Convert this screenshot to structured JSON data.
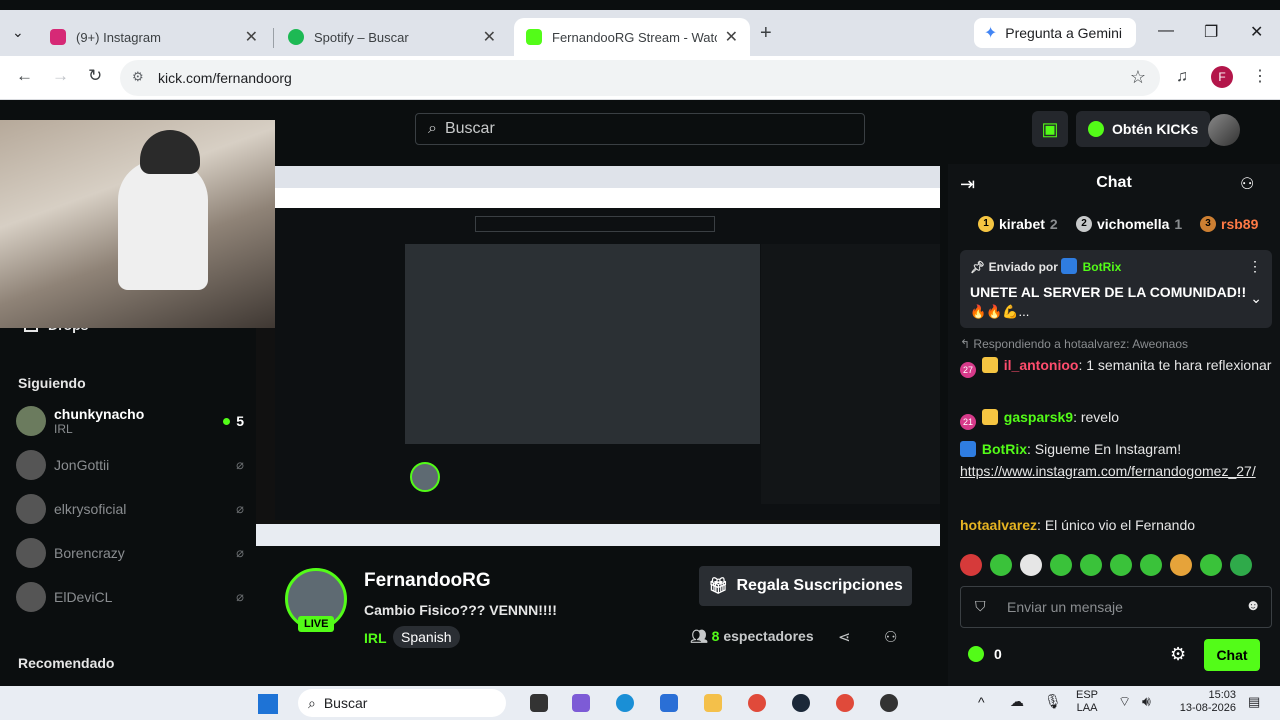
{
  "browser": {
    "tabs": [
      {
        "title": "(9+) Instagram",
        "favicon": "instagram-icon",
        "color": "#d62976"
      },
      {
        "title": "Spotify – Buscar",
        "favicon": "spotify-icon",
        "color": "#1db954"
      },
      {
        "title": "FernandooRG Stream - Watch l",
        "favicon": "kick-icon",
        "color": "#53fc18"
      }
    ],
    "gemini_label": "Pregunta a Gemini",
    "url": "kick.com/fernandoorg",
    "profile_initial": "F"
  },
  "kick": {
    "search_placeholder": "Buscar",
    "kicks_label": "Obtén KICKs",
    "sidebar": {
      "drops_label": "Drops",
      "following_label": "Siguiendo",
      "recommended_label": "Recomendado",
      "channels": [
        {
          "name": "chunkynacho",
          "category": "IRL",
          "viewers": "5",
          "live": true
        },
        {
          "name": "JonGottii",
          "live": false
        },
        {
          "name": "elkrysoficial",
          "live": false
        },
        {
          "name": "Borencrazy",
          "live": false
        },
        {
          "name": "ElDeviCL",
          "live": false
        }
      ]
    },
    "channel": {
      "name": "FernandooRG",
      "live_label": "LIVE",
      "title": "Cambio Fisico??? VENNN!!!!",
      "category": "IRL",
      "language": "Spanish",
      "subscribe_label": "Regala Suscripciones",
      "viewers_count": "8",
      "viewers_label": "espectadores"
    },
    "chat": {
      "title": "Chat",
      "gifters": [
        {
          "rank": "1",
          "name": "kirabet",
          "count": "2"
        },
        {
          "rank": "2",
          "name": "vichomella",
          "count": "1"
        },
        {
          "rank": "3",
          "name": "rsb89"
        }
      ],
      "pinned": {
        "by_label": "Enviado por",
        "by_user": "BotRix",
        "text": "UNETE AL SERVER DE LA COMUNIDAD!!",
        "emoji": "🔥🔥💪..."
      },
      "reply_to": "Respondiendo a hotaalvarez: Aweonaos",
      "messages": [
        {
          "badge": "27",
          "user": "il_antonioo",
          "color": "#ff4d6d",
          "text": "1 semanita te hara reflexionar"
        },
        {
          "badge": "21",
          "user": "gasparsk9",
          "color": "#53fc18",
          "text": "revelo"
        },
        {
          "user": "BotRix",
          "color": "#53fc18",
          "text": "Sigueme En Instagram!",
          "link": "https://www.instagram.com/fernandogomez_27/"
        },
        {
          "user": "hotaalvarez",
          "color": "#e6b422",
          "text": "El único vio el Fernando"
        }
      ],
      "input_placeholder": "Enviar un mensaje",
      "kicks_balance": "0",
      "send_label": "Chat"
    }
  },
  "taskbar": {
    "search_label": "Buscar",
    "lang_top": "ESP",
    "lang_bottom": "LAA",
    "time": "15:03",
    "date": "13-08-2026"
  }
}
